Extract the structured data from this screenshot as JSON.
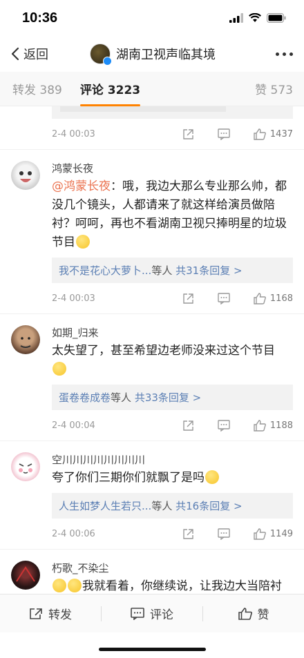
{
  "status_bar": {
    "time": "10:36"
  },
  "nav": {
    "back_label": "返回",
    "title": "湖南卫视声临其境"
  },
  "tabs": {
    "repost_label": "转发",
    "repost_count": "389",
    "comment_label": "评论",
    "comment_count": "3223",
    "like_label": "赞",
    "like_count": "573"
  },
  "first_meta": {
    "time": "2-4 00:03",
    "likes": "1437"
  },
  "comments": [
    {
      "username": "鸿蒙长夜",
      "mention": "@鸿蒙长夜",
      "text": "：哦，我边大那么专业那么帅，都没几个镜头，人都请来了就这样给演员做陪衬？呵呵，再也不看湖南卫视只捧明星的垃圾节目",
      "replies_by": "我不是花心大萝卜...",
      "replies_suffix": "等人",
      "replies_total": "共31条回复 >",
      "time": "2-4 00:03",
      "likes": "1168"
    },
    {
      "username": "如期_归来",
      "text": "太失望了，甚至希望边老师没来过这个节目",
      "replies_by": "蛋卷卷成卷",
      "replies_suffix": "等人",
      "replies_total": "共33条回复 >",
      "time": "2-4 00:04",
      "likes": "1188"
    },
    {
      "username": "空川川川川川川川川",
      "text": "夸了你们三期你们就飘了是吗",
      "replies_by": "人生如梦人生若只...",
      "replies_suffix": "等人",
      "replies_total": "共16条回复 >",
      "time": "2-4 00:06",
      "likes": "1149"
    },
    {
      "username": "朽歌_不染尘",
      "text": "我就看着，你继续说，让我边大当陪衬你们也是够够的了"
    }
  ],
  "bottom_bar": {
    "repost": "转发",
    "comment": "评论",
    "like": "赞"
  },
  "colors": {
    "accent": "#ff8200",
    "link": "#5b7fb4",
    "mention": "#eb7350"
  }
}
